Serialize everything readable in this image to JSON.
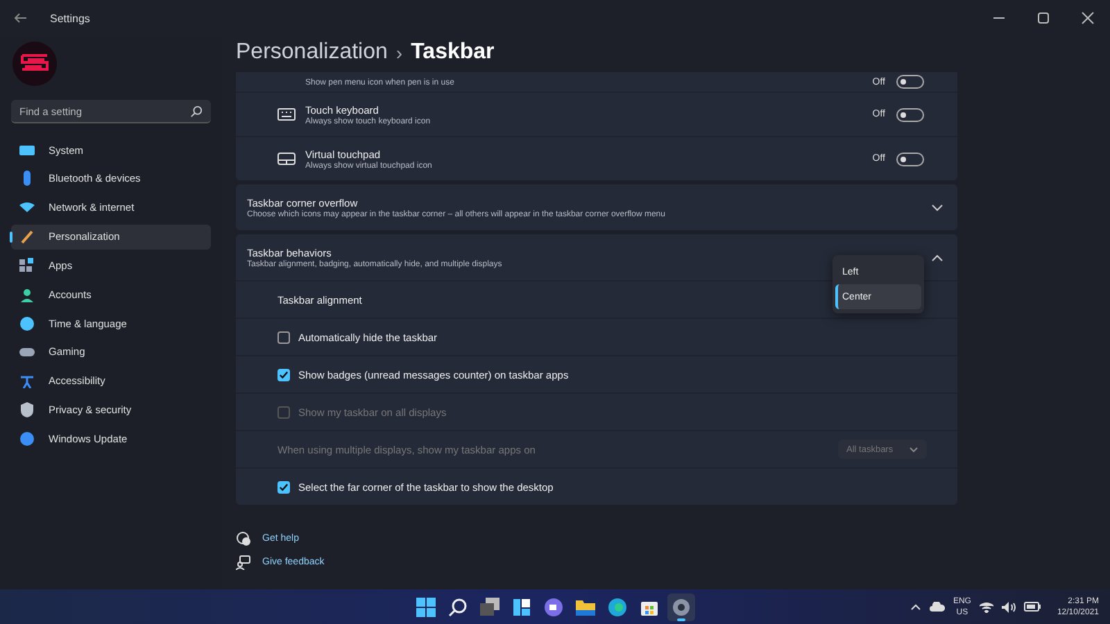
{
  "window": {
    "title": "Settings"
  },
  "search": {
    "placeholder": "Find a setting"
  },
  "sidebar": {
    "items": [
      {
        "label": "System",
        "selected": false
      },
      {
        "label": "Bluetooth & devices",
        "selected": false
      },
      {
        "label": "Network & internet",
        "selected": false
      },
      {
        "label": "Personalization",
        "selected": true
      },
      {
        "label": "Apps",
        "selected": false
      },
      {
        "label": "Accounts",
        "selected": false
      },
      {
        "label": "Time & language",
        "selected": false
      },
      {
        "label": "Gaming",
        "selected": false
      },
      {
        "label": "Accessibility",
        "selected": false
      },
      {
        "label": "Privacy & security",
        "selected": false
      },
      {
        "label": "Windows Update",
        "selected": false
      }
    ]
  },
  "breadcrumb": {
    "parent": "Personalization",
    "separator": "›",
    "current": "Taskbar"
  },
  "toggle_rows": [
    {
      "subtitle": "Show pen menu icon when pen is in use",
      "state": "Off",
      "on": false
    },
    {
      "title": "Touch keyboard",
      "subtitle": "Always show touch keyboard icon",
      "state": "Off",
      "on": false
    },
    {
      "title": "Virtual touchpad",
      "subtitle": "Always show virtual touchpad icon",
      "state": "Off",
      "on": false
    }
  ],
  "sections": [
    {
      "title": "Taskbar corner overflow",
      "subtitle": "Choose which icons may appear in the taskbar corner – all others will appear in the taskbar corner overflow menu",
      "expanded": false
    },
    {
      "title": "Taskbar behaviors",
      "subtitle": "Taskbar alignment, badging, automatically hide, and multiple displays",
      "expanded": true
    }
  ],
  "behaviors": [
    {
      "kind": "label",
      "label": "Taskbar alignment",
      "disabled": false
    },
    {
      "kind": "checkbox",
      "label": "Automatically hide the taskbar",
      "checked": false,
      "disabled": false
    },
    {
      "kind": "checkbox",
      "label": "Show badges (unread messages counter) on taskbar apps",
      "checked": true,
      "disabled": false
    },
    {
      "kind": "checkbox",
      "label": "Show my taskbar on all displays",
      "checked": false,
      "disabled": true
    },
    {
      "kind": "dropdown",
      "label": "When using multiple displays, show my taskbar apps on",
      "value": "All taskbars",
      "disabled": true
    },
    {
      "kind": "checkbox",
      "label": "Select the far corner of the taskbar to show the desktop",
      "checked": true,
      "disabled": false
    }
  ],
  "alignment_menu": {
    "options": [
      {
        "label": "Left",
        "selected": false
      },
      {
        "label": "Center",
        "selected": true
      }
    ]
  },
  "help_links": [
    {
      "label": "Get help"
    },
    {
      "label": "Give feedback"
    }
  ],
  "taskbar": {
    "apps": [
      {
        "selected": false
      },
      {
        "selected": false
      },
      {
        "selected": false
      },
      {
        "selected": false
      },
      {
        "selected": false
      },
      {
        "selected": false
      },
      {
        "selected": false
      },
      {
        "selected": false
      },
      {
        "selected": true
      }
    ],
    "language": "ENG",
    "region": "US",
    "time": "2:31 PM",
    "date": "12/10/2021"
  }
}
